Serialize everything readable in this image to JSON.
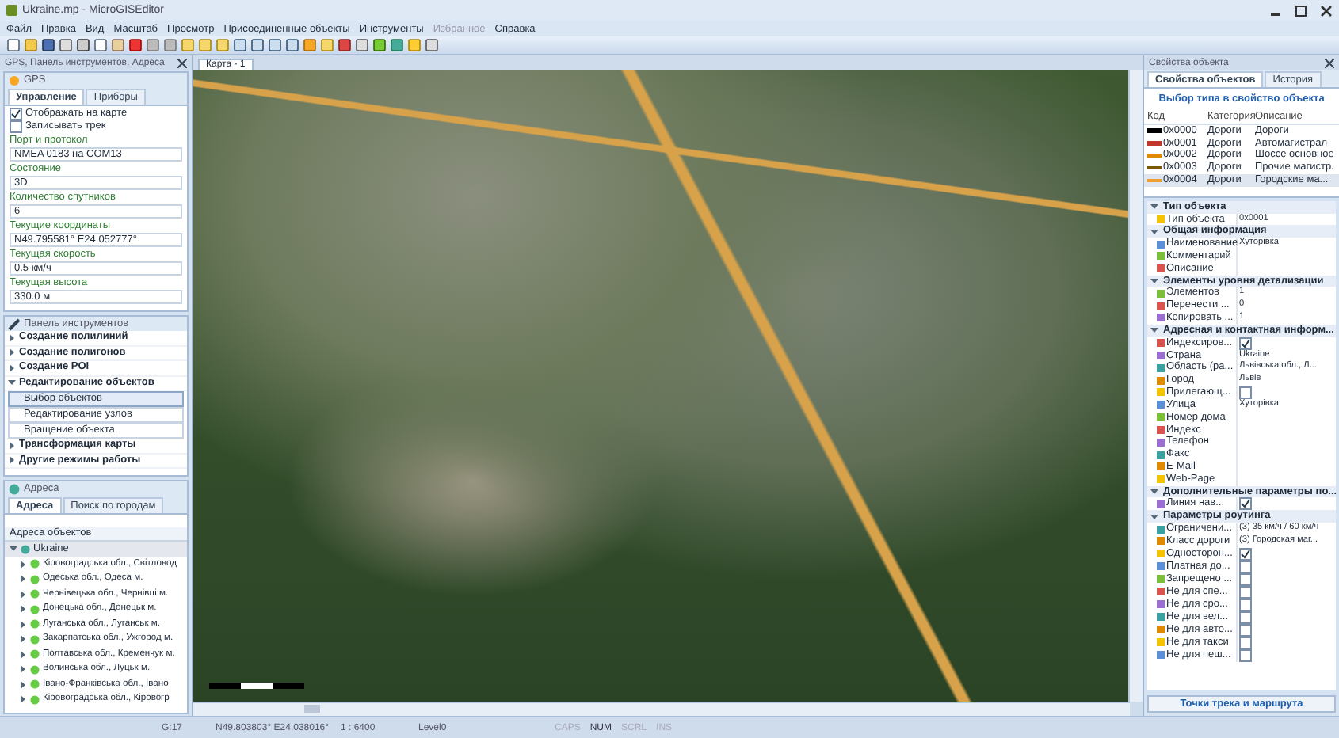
{
  "window": {
    "title": "Ukraine.mp - MicroGISEditor"
  },
  "menu": [
    {
      "label": "Файл",
      "disabled": false
    },
    {
      "label": "Правка",
      "disabled": false
    },
    {
      "label": "Вид",
      "disabled": false
    },
    {
      "label": "Масштаб",
      "disabled": false
    },
    {
      "label": "Просмотр",
      "disabled": false
    },
    {
      "label": "Присоединенные объекты",
      "disabled": false
    },
    {
      "label": "Инструменты",
      "disabled": false
    },
    {
      "label": "Избранное",
      "disabled": true
    },
    {
      "label": "Справка",
      "disabled": false
    }
  ],
  "left_panel": {
    "title": "GPS, Панель инструментов, Адреса",
    "gps": {
      "title": "GPS",
      "tabs": [
        {
          "label": "Управление",
          "selected": true
        },
        {
          "label": "Приборы",
          "selected": false
        }
      ],
      "options": [
        {
          "label": "Отображать на карте",
          "checked": true
        },
        {
          "label": "Записывать трек",
          "checked": false
        }
      ],
      "fields": [
        {
          "label": "Порт и протокол",
          "value": "NMEA 0183 на COM13"
        },
        {
          "label": "Состояние",
          "value": "3D"
        },
        {
          "label": "Количество спутников",
          "value": "6"
        },
        {
          "label": "Текущие координаты",
          "value": "N49.795581° E24.052777°"
        },
        {
          "label": "Текущая скорость",
          "value": "0.5 км/ч"
        },
        {
          "label": "Текущая высота",
          "value": "330.0 м"
        }
      ]
    },
    "tools": {
      "title": "Панель инструментов",
      "groups": [
        {
          "label": "Создание полилиний",
          "expanded": false
        },
        {
          "label": "Создание полигонов",
          "expanded": false
        },
        {
          "label": "Создание POI",
          "expanded": false
        },
        {
          "label": "Редактирование объектов",
          "expanded": true,
          "children": [
            {
              "label": "Выбор объектов",
              "selected": true
            },
            {
              "label": "Редактирование узлов",
              "selected": false
            },
            {
              "label": "Вращение объекта",
              "selected": false
            }
          ]
        },
        {
          "label": "Трансформация карты",
          "expanded": false
        },
        {
          "label": "Другие режимы работы",
          "expanded": false
        }
      ]
    },
    "addresses": {
      "title": "Адреса",
      "tabs": [
        {
          "label": "Адреса",
          "selected": true
        },
        {
          "label": "Поиск по городам",
          "selected": false
        }
      ],
      "column": "Адреса объектов",
      "tree": [
        {
          "label": "Ukraine",
          "expanded": true,
          "selected": true,
          "children": [
            {
              "label": "Кіровоградська обл., Світловод",
              "expanded": false,
              "selected": false
            },
            {
              "label": "Одеська обл., Одеса м.",
              "expanded": false,
              "selected": false
            },
            {
              "label": "Чернівецька обл., Чернівці м.",
              "expanded": false,
              "selected": false
            },
            {
              "label": "Донецька обл., Донецьк м.",
              "expanded": false,
              "selected": false
            },
            {
              "label": "Луганська обл., Луганськ м.",
              "expanded": false,
              "selected": false
            },
            {
              "label": "Закарпатська обл., Ужгород м.",
              "expanded": false,
              "selected": false
            },
            {
              "label": "Полтавська обл., Кременчук м.",
              "expanded": false,
              "selected": false
            },
            {
              "label": "Волинська обл., Луцьк м.",
              "expanded": false,
              "selected": false
            },
            {
              "label": "Івано-Франківська обл., Івано",
              "expanded": false,
              "selected": false
            },
            {
              "label": "Кіровоградська обл., Кіровогр",
              "expanded": false,
              "selected": false
            }
          ]
        }
      ]
    }
  },
  "map": {
    "tab": "Карта - 1"
  },
  "right_panel": {
    "title": "Свойства объекта",
    "tabs": [
      {
        "label": "Свойства объектов",
        "selected": true
      },
      {
        "label": "История",
        "selected": false
      }
    ],
    "link": "Выбор типа в свойство объекта",
    "table": {
      "columns": [
        "Код",
        "Категория",
        "Описание"
      ],
      "rows": [
        {
          "code": "0x0000",
          "category": "Дороги",
          "description": "Дороги",
          "color": "#000000",
          "selected": false
        },
        {
          "code": "0x0001",
          "category": "Дороги",
          "description": "Автомагистрал",
          "color": "#c0392b",
          "selected": false
        },
        {
          "code": "0x0002",
          "category": "Дороги",
          "description": "Шоссе основное",
          "color": "#e08a00",
          "selected": false
        },
        {
          "code": "0x0003",
          "category": "Дороги",
          "description": "Прочие магистр.",
          "color": "#7a5a00",
          "selected": false
        },
        {
          "code": "0x0004",
          "category": "Дороги",
          "description": "Городские ма...",
          "color": "#f0a030",
          "selected": true
        }
      ]
    },
    "properties": [
      {
        "category": "Тип объекта",
        "expanded": true,
        "items": [
          {
            "kind": "text",
            "name": "Тип объекта",
            "value": "0x0001"
          }
        ]
      },
      {
        "category": "Общая информация",
        "expanded": true,
        "items": [
          {
            "kind": "text",
            "name": "Наименование",
            "value": "Хуторівка"
          },
          {
            "kind": "text",
            "name": "Комментарий"
          },
          {
            "kind": "text",
            "name": "Описание"
          }
        ]
      },
      {
        "category": "Элементы уровня детализации",
        "expanded": true,
        "items": [
          {
            "kind": "text",
            "name": "Элементов",
            "value": "1"
          },
          {
            "kind": "text",
            "name": "Перенести ...",
            "value": "0"
          },
          {
            "kind": "text",
            "name": "Копировать ...",
            "value": "1"
          }
        ]
      },
      {
        "category": "Адресная и контактная информ...",
        "expanded": true,
        "items": [
          {
            "kind": "check",
            "name": "Индексиров...",
            "checked": true
          },
          {
            "kind": "text",
            "name": "Страна",
            "value": "Ukraine"
          },
          {
            "kind": "text",
            "name": "Область (ра...",
            "value": "Львівська обл., Л..."
          },
          {
            "kind": "text",
            "name": "Город",
            "value": "Львів"
          },
          {
            "kind": "check",
            "name": "Прилегающ...",
            "checked": false
          },
          {
            "kind": "text",
            "name": "Улица",
            "value": "Хуторівка"
          },
          {
            "kind": "text",
            "name": "Номер дома"
          },
          {
            "kind": "text",
            "name": "Индекс"
          },
          {
            "kind": "text",
            "name": "Телефон"
          },
          {
            "kind": "text",
            "name": "Факс"
          },
          {
            "kind": "text",
            "name": "E-Mail"
          },
          {
            "kind": "text",
            "name": "Web-Page"
          }
        ]
      },
      {
        "category": "Дополнительные параметры по...",
        "expanded": true,
        "items": [
          {
            "kind": "check",
            "name": "Линия нав...",
            "checked": true
          }
        ]
      },
      {
        "category": "Параметры роутинга",
        "expanded": true,
        "items": [
          {
            "kind": "text",
            "name": "Ограничени...",
            "value": "(3) 35 км/ч / 60 км/ч"
          },
          {
            "kind": "text",
            "name": "Класс дороги",
            "value": "(3) Городская маг..."
          },
          {
            "kind": "check",
            "name": "Односторон...",
            "checked": true
          },
          {
            "kind": "check",
            "name": "Платная до...",
            "checked": false
          },
          {
            "kind": "check",
            "name": "Запрещено ...",
            "checked": false
          },
          {
            "kind": "check",
            "name": "Не для спе...",
            "checked": false
          },
          {
            "kind": "check",
            "name": "Не для сро...",
            "checked": false
          },
          {
            "kind": "check",
            "name": "Не для вел...",
            "checked": false
          },
          {
            "kind": "check",
            "name": "Не для авто...",
            "checked": false
          },
          {
            "kind": "check",
            "name": "Не для такси",
            "checked": false
          },
          {
            "kind": "check",
            "name": "Не для пеш...",
            "checked": false
          }
        ]
      }
    ],
    "footer_button": "Точки трека и маршрута"
  },
  "status_bar": {
    "satellites": "G:17",
    "coordinates": "N49.803803° E24.038016°",
    "scale": "1 : 6400",
    "level": "Level0",
    "indicators": [
      {
        "label": "CAPS",
        "on": false
      },
      {
        "label": "NUM",
        "on": true
      },
      {
        "label": "SCRL",
        "on": false
      },
      {
        "label": "INS",
        "on": false
      }
    ]
  }
}
